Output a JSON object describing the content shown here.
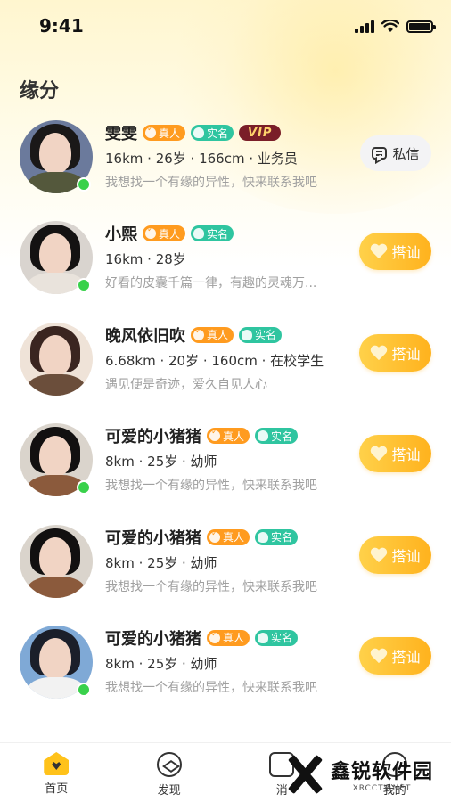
{
  "status_bar": {
    "time": "9:41"
  },
  "page_title": "缘分",
  "labels": {
    "real": "真人",
    "name": "实名",
    "vip": "VIP",
    "chat": "私信",
    "greet": "搭讪"
  },
  "users": [
    {
      "name": "雯雯",
      "meta": "16km · 26岁 · 166cm · 业务员",
      "bio": "我想找一个有缘的异性，快来联系我吧",
      "vip": true,
      "online": true,
      "action": "chat",
      "hair": "#1a1818",
      "body": "#54583c",
      "bg": "#6b7a9c"
    },
    {
      "name": "小熙",
      "meta": "16km · 28岁",
      "bio": "好看的皮囊千篇一律，有趣的灵魂万...",
      "vip": false,
      "online": true,
      "action": "greet",
      "hair": "#141212",
      "body": "#e9e3dc",
      "bg": "#d9d4cf"
    },
    {
      "name": "晚风依旧吹",
      "meta": "6.68km · 20岁 · 160cm · 在校学生",
      "bio": "遇见便是奇迹，爱久自见人心",
      "vip": false,
      "online": false,
      "action": "greet",
      "hair": "#3a2520",
      "body": "#6b4e3b",
      "bg": "#efe3d8"
    },
    {
      "name": "可爱的小猪猪",
      "meta": "8km · 25岁 · 幼师",
      "bio": "我想找一个有缘的异性，快来联系我吧",
      "vip": false,
      "online": true,
      "action": "greet",
      "hair": "#121010",
      "body": "#8b5a3c",
      "bg": "#dad4cc"
    },
    {
      "name": "可爱的小猪猪",
      "meta": "8km · 25岁 · 幼师",
      "bio": "我想找一个有缘的异性，快来联系我吧",
      "vip": false,
      "online": false,
      "action": "greet",
      "hair": "#121010",
      "body": "#8b5a3c",
      "bg": "#dad4cc"
    },
    {
      "name": "可爱的小猪猪",
      "meta": "8km · 25岁 · 幼师",
      "bio": "我想找一个有缘的异性，快来联系我吧",
      "vip": false,
      "online": true,
      "action": "greet",
      "hair": "#1b1f2a",
      "body": "#f2f2f2",
      "bg": "#7fa9d6"
    }
  ],
  "tabbar": {
    "home": "首页",
    "discover": "发现",
    "msg": "消",
    "me": "我的"
  },
  "watermark": {
    "title": "鑫锐软件园",
    "sub": "XRCCTV.NET"
  },
  "colors": {
    "accent": "#ffb21d",
    "online": "#39d14b",
    "real_tag": "#ff9b1f",
    "name_tag": "#2fc5a0",
    "vip_tag": "#7a1e28"
  }
}
